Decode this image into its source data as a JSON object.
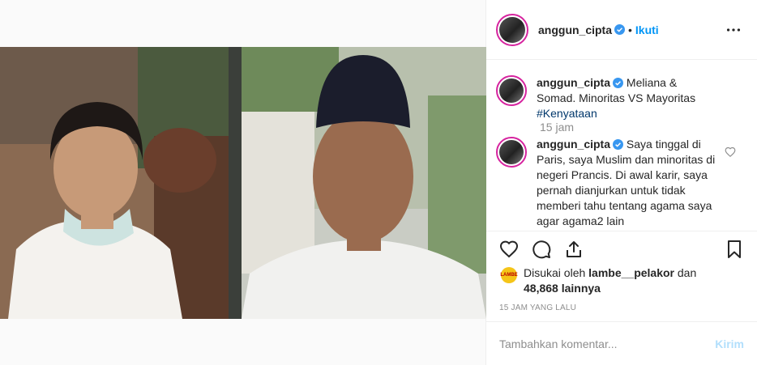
{
  "post": {
    "username": "anggun_cipta",
    "follow_label": "Ikuti",
    "separator": "•",
    "images": [
      "left-photo",
      "right-photo"
    ]
  },
  "caption": {
    "username": "anggun_cipta",
    "text": "Meliana & Somad. Minoritas VS Mayoritas ",
    "hashtag": "#Kenyataan",
    "time": "15 jam"
  },
  "comment": {
    "username": "anggun_cipta",
    "text": "Saya tinggal di Paris, saya Muslim dan minoritas di negeri Prancis. Di awal karir, saya pernah dianjurkan untuk tidak memberi tahu tentang agama saya agar agama2 lain"
  },
  "likes": {
    "prefix": "Disukai oleh ",
    "user": "lambe__pelakor",
    "mid": " dan ",
    "count": "48,868 lainnya",
    "avatar_label": "LAMBE"
  },
  "timestamp": "15 JAM YANG LALU",
  "composer": {
    "placeholder": "Tambahkan komentar...",
    "post_label": "Kirim"
  },
  "colors": {
    "accent": "#0095f6",
    "verified": "#3897f0",
    "post_disabled": "#b2dffc"
  },
  "icons": [
    "verified-icon",
    "more-icon",
    "heart-icon",
    "comment-icon",
    "share-icon",
    "bookmark-icon",
    "heart-small-icon"
  ]
}
